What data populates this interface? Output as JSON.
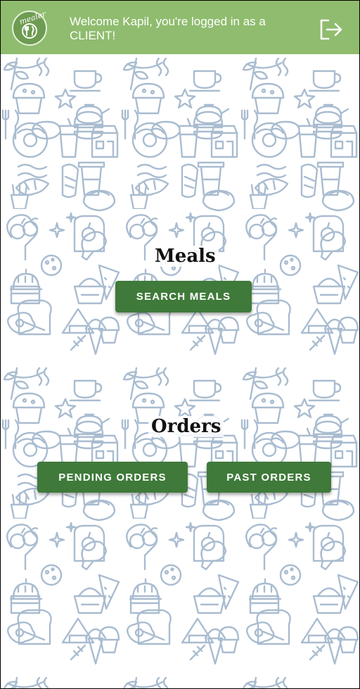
{
  "header": {
    "logo_text": "mealer",
    "welcome_text": "Welcome Kapil, you're logged in as a CLIENT!",
    "logout_icon": "logout-icon",
    "background_color": "#8fbc6e"
  },
  "meals": {
    "title": "Meals",
    "search_button": "SEARCH MEALS"
  },
  "orders": {
    "title": "Orders",
    "pending_button": "PENDING ORDERS",
    "past_button": "PAST ORDERS"
  },
  "colors": {
    "button": "#3f7a3a",
    "doodle": "#a9bcd0"
  }
}
